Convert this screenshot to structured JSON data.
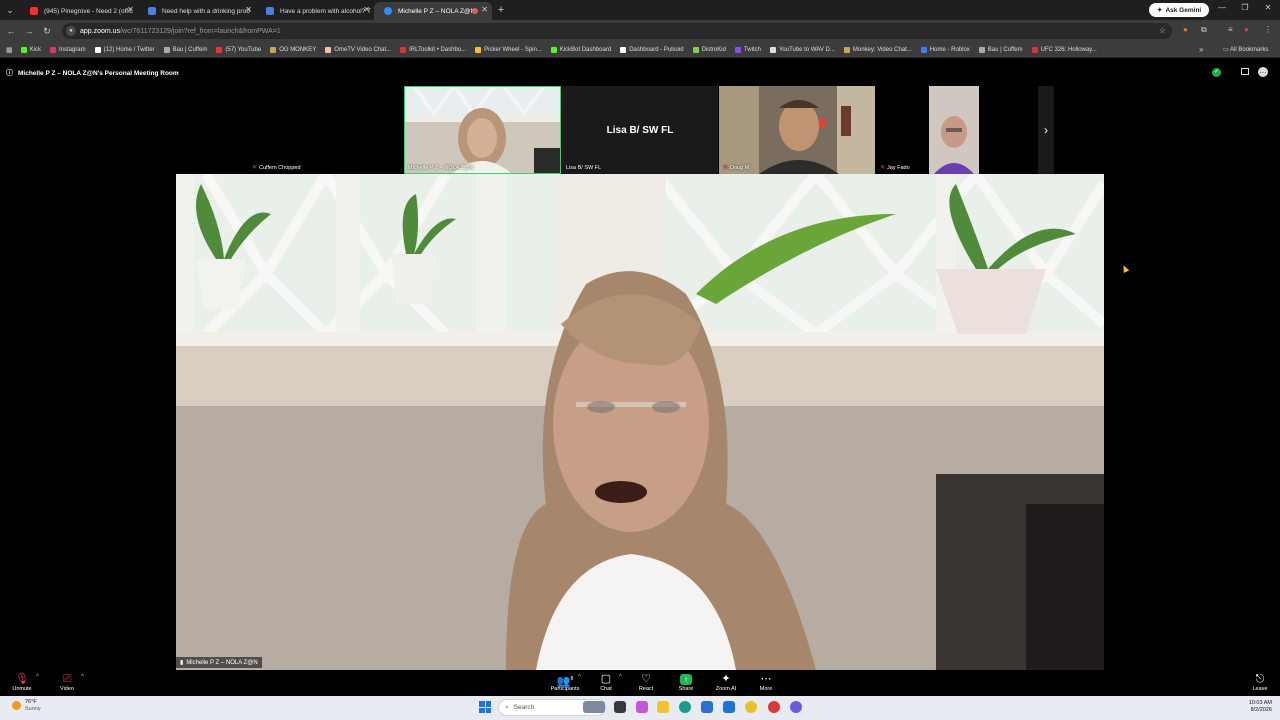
{
  "browser": {
    "tabs": [
      {
        "label": "(945) Pinegrove - Need 2 (offic",
        "icon": "youtube-icon",
        "color": "#ff2d2d",
        "active": false
      },
      {
        "label": "Need help with a drinking prob",
        "icon": "page-icon",
        "color": "#4a7fe0",
        "active": false
      },
      {
        "label": "Have a problem with alcohol? T",
        "icon": "page-icon",
        "color": "#4a7fe0",
        "active": false
      },
      {
        "label": "Michelle P Z – NOLA Z@N",
        "icon": "zoom-icon",
        "color": "#2d8cff",
        "active": true
      }
    ],
    "ask_gemini": "Ask Gemini",
    "url_host": "app.zoom.us",
    "url_path": "/wc/7611723129/join?ref_from=launch&fromPWA=1",
    "bookmarks": [
      {
        "label": "Kick",
        "color": "#53fc18"
      },
      {
        "label": "Instagram",
        "color": "#e1306c"
      },
      {
        "label": "(12) Home / Twitter",
        "color": "#ffffff"
      },
      {
        "label": "Bau | Cuffem",
        "color": "#aaaaaa"
      },
      {
        "label": "(57) YouTube",
        "color": "#ff2d2d"
      },
      {
        "label": "OG MONKEY",
        "color": "#c8a45a"
      },
      {
        "label": "OmeTV Video Chat...",
        "color": "#f4c2a0"
      },
      {
        "label": "IRLToolkit • Dashbo...",
        "color": "#e03030"
      },
      {
        "label": "Picker Wheel - Spin...",
        "color": "#f2c230"
      },
      {
        "label": "KickBot Dashboard",
        "color": "#53fc18"
      },
      {
        "label": "Dashboard - Pulsoid",
        "color": "#ffffff"
      },
      {
        "label": "DistroKid",
        "color": "#7bd148"
      },
      {
        "label": "Twitch",
        "color": "#9146ff"
      },
      {
        "label": "YouTube to WAV D...",
        "color": "#dddddd"
      },
      {
        "label": "Monkey: Video Chat...",
        "color": "#c8a45a"
      },
      {
        "label": "Home - Roblox",
        "color": "#3b82f6"
      },
      {
        "label": "Bau | Cuffem",
        "color": "#aaaaaa"
      },
      {
        "label": "UFC 326: Holloway...",
        "color": "#e03030"
      }
    ],
    "all_bookmarks": "All Bookmarks"
  },
  "meeting": {
    "title": "Michelle P Z – NOLA Z@N's Personal Meeting Room",
    "participants_tiles": [
      {
        "name": "Cuffem Chopped",
        "muted": true
      },
      {
        "name": "Michelle P Z – NOLA Z@N",
        "muted": false
      },
      {
        "name": "Lisa B/ SW FL",
        "muted": false,
        "display": "Lisa B/ SW FL"
      },
      {
        "name": "Doug M",
        "muted": true
      },
      {
        "name": "Jay Fado",
        "muted": true
      }
    ],
    "main_speaker": "Michelle P Z – NOLA Z@N"
  },
  "toolbar": {
    "unmute": "Unmute",
    "video": "Video",
    "participants": "Participants",
    "participants_count": "8",
    "chat": "Chat",
    "react": "React",
    "share": "Share",
    "zoom_ai": "Zoom AI",
    "more": "More",
    "leave": "Leave"
  },
  "taskbar": {
    "temp": "76°F",
    "weather": "Sunny",
    "search": "Search",
    "time": "10:03 AM",
    "date": "8/2/2026"
  }
}
